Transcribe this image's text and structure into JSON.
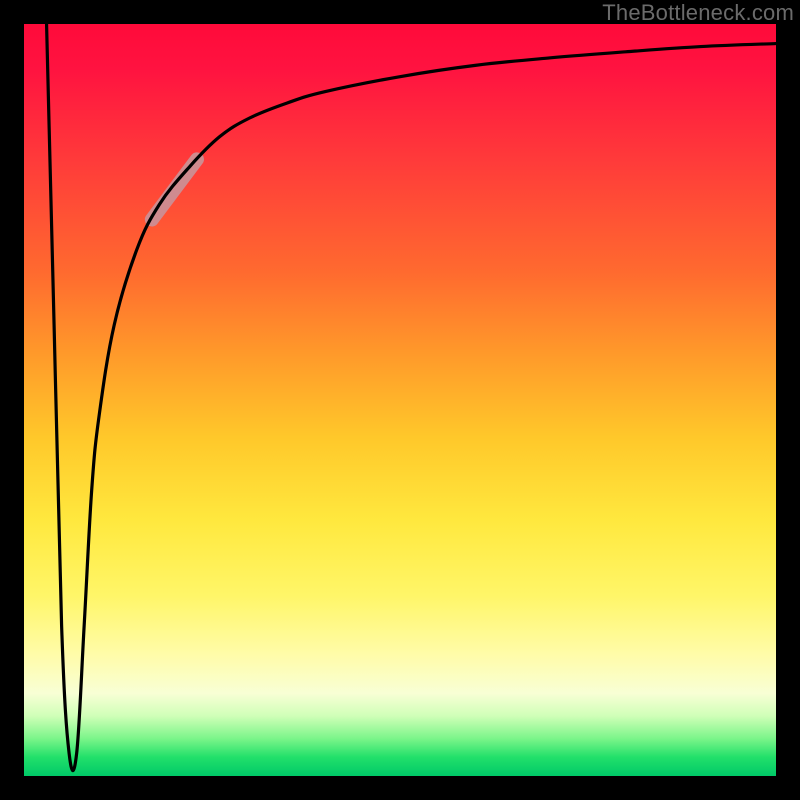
{
  "watermark": {
    "text": "TheBottleneck.com"
  },
  "chart_data": {
    "type": "line",
    "title": "",
    "xlabel": "",
    "ylabel": "",
    "xlim": [
      0,
      100
    ],
    "ylim": [
      0,
      100
    ],
    "grid": false,
    "legend": false,
    "background_gradient": {
      "top_color": "#ff0a3a",
      "bottom_color": "#00c968",
      "note": "vertical red→yellow→green gradient, green only near very bottom"
    },
    "series": [
      {
        "name": "bottleneck-curve",
        "stroke": "#000000",
        "x": [
          3,
          4,
          5,
          6,
          7,
          8,
          9,
          10,
          12,
          15,
          18,
          22,
          26,
          30,
          35,
          40,
          50,
          60,
          70,
          80,
          90,
          100
        ],
        "y": [
          100,
          60,
          20,
          3,
          3,
          20,
          38,
          48,
          60,
          70,
          76,
          81,
          85,
          87.5,
          89.5,
          91,
          93,
          94.5,
          95.5,
          96.3,
          97,
          97.4
        ],
        "note": "y is percent of vertical extent from bottom (0) to top (100); curve drops sharply from top-left to a narrow minimum near x≈6 then rises and asymptotes near the top"
      },
      {
        "name": "marker-segment",
        "stroke": "#cf8b8f",
        "stroke_width_px": 14,
        "linecap": "round",
        "x": [
          17,
          23
        ],
        "y": [
          74,
          82
        ],
        "note": "short thick pale-rose segment laid on the rising portion of the curve"
      }
    ]
  }
}
